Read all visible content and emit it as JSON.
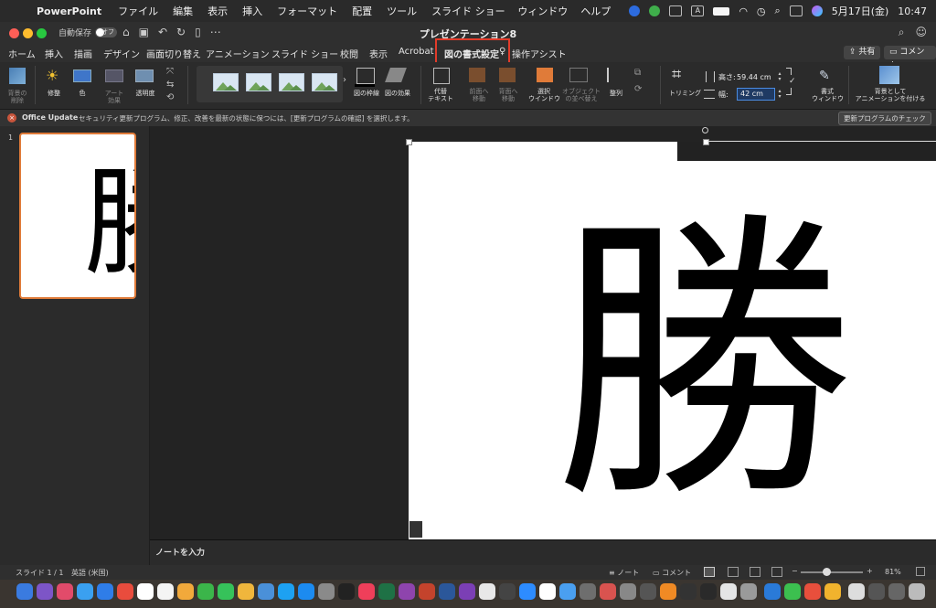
{
  "menubar": {
    "app": "PowerPoint",
    "items": [
      "ファイル",
      "編集",
      "表示",
      "挿入",
      "フォーマット",
      "配置",
      "ツール",
      "スライド ショー",
      "ウィンドウ",
      "ヘルプ"
    ],
    "date": "5月17日(金)",
    "time": "10:47"
  },
  "titlebar": {
    "autosave_label": "自動保存",
    "autosave_state": "オフ",
    "title": "プレゼンテーション8"
  },
  "tabs": [
    "ホーム",
    "挿入",
    "描画",
    "デザイン",
    "画面切り替え",
    "アニメーション",
    "スライド ショー",
    "校閲",
    "表示",
    "Acrobat",
    "図の書式設定",
    "操作アシスト"
  ],
  "active_tab": "図の書式設定",
  "tab_buttons": {
    "share": "共有",
    "comment": "コメント"
  },
  "ribbon": {
    "remove_bg": "背景の\n削除",
    "corrections": "修整",
    "color": "色",
    "artistic": "アート\n効果",
    "transparency": "透明度",
    "picture_border": "図の枠線",
    "picture_effects": "図の効果",
    "alt_text": "代替\nテキスト",
    "bring_forward": "前面へ\n移動",
    "send_backward": "背面へ\n移動",
    "selection_pane": "選択\nウインドウ",
    "arrange_objects": "オブジェクト\nの並べ替え",
    "align": "整列",
    "crop": "トリミング",
    "height_label": "高さ:",
    "height_value": "59.44 cm",
    "width_label": "幅:",
    "width_value": "42 cm",
    "format_pane": "書式\nウィンドウ",
    "animate_bg": "背景として\nアニメーションを付ける"
  },
  "notice": {
    "title": "Office Update",
    "message": "セキュリティ更新プログラム、修正、改善を最新の状態に保つには、[更新プログラムの確認] を選択します。",
    "button": "更新プログラムのチェック"
  },
  "slide_number": "1",
  "slide_text": "勝",
  "notes_placeholder": "ノートを入力",
  "status": {
    "slide": "スライド 1 / 1",
    "language": "英語 (米国)",
    "notes": "ノート",
    "comments": "コメント",
    "zoom": "81%"
  },
  "colors": {
    "highlight": "#e23b2a",
    "accent": "#e07b39"
  }
}
